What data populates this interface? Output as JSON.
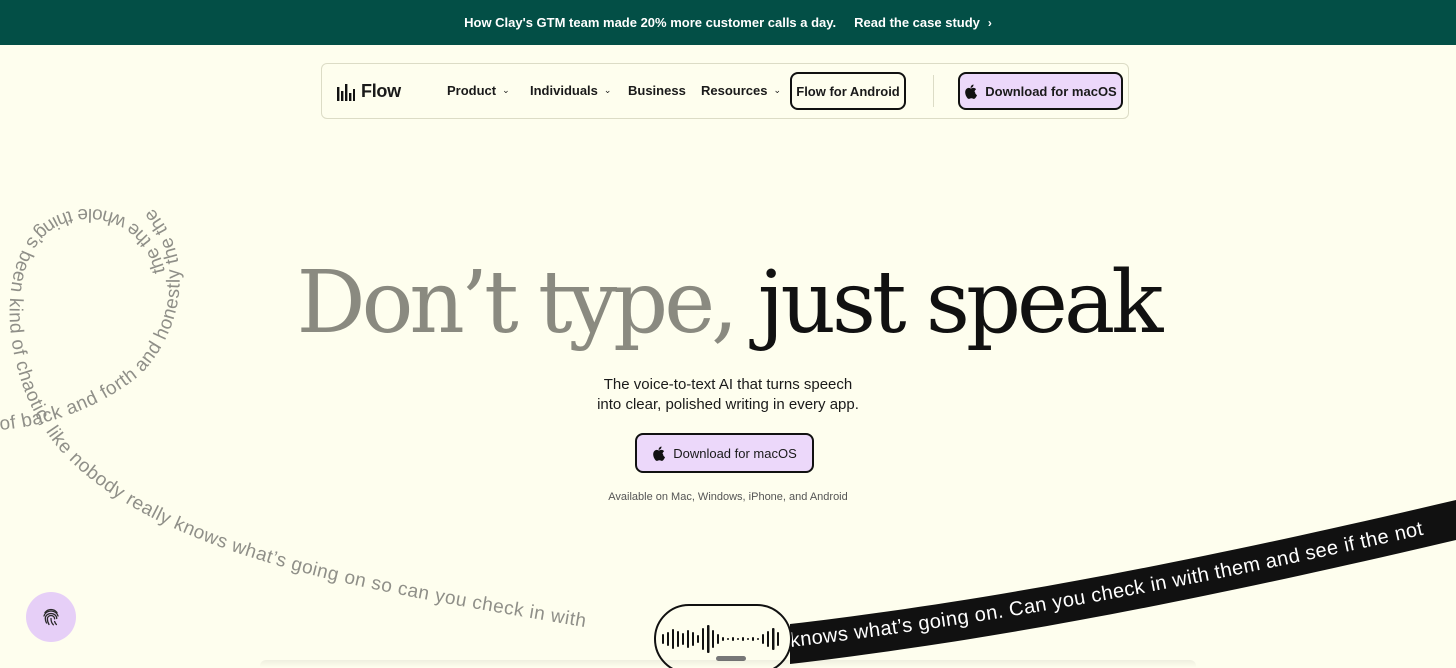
{
  "banner": {
    "text": "How Clay's GTM team made 20% more customer calls a day.",
    "link": "Read the case study",
    "chevron": "›"
  },
  "nav": {
    "logo": "Flow",
    "items": [
      {
        "label": "Product",
        "has_dropdown": true
      },
      {
        "label": "Individuals",
        "has_dropdown": true
      },
      {
        "label": "Business",
        "has_dropdown": false
      },
      {
        "label": "Resources",
        "has_dropdown": true
      }
    ],
    "android_button": "Flow for Android",
    "mac_button": "Download for macOS"
  },
  "hero": {
    "headline_grey": "Don’t type,",
    "headline_dark": "just speak",
    "sub_line1": "The voice-to-text AI that turns speech",
    "sub_line2": "into clear, polished writing in every app.",
    "cta": "Download for macOS",
    "availability": "Available on Mac, Windows, iPhone, and Android"
  },
  "swirl": {
    "circle_text": "the the whole thing’s been kind of chaotic, like nobody really knows what’s going on so can you check in with",
    "tail_text": "of back and forth and honestly the the whole",
    "ribbon_text": "knows what’s going on. Can you check in with them and see if the not"
  },
  "colors": {
    "banner_bg": "#034f46",
    "page_bg": "#fefeee",
    "accent_purple": "#ecd8fa",
    "grey_text": "#8a8a80"
  },
  "icons": {
    "apple": "apple-icon",
    "logo": "flow-bars-icon",
    "fingerprint": "fingerprint-icon",
    "waveform": "waveform-icon"
  }
}
